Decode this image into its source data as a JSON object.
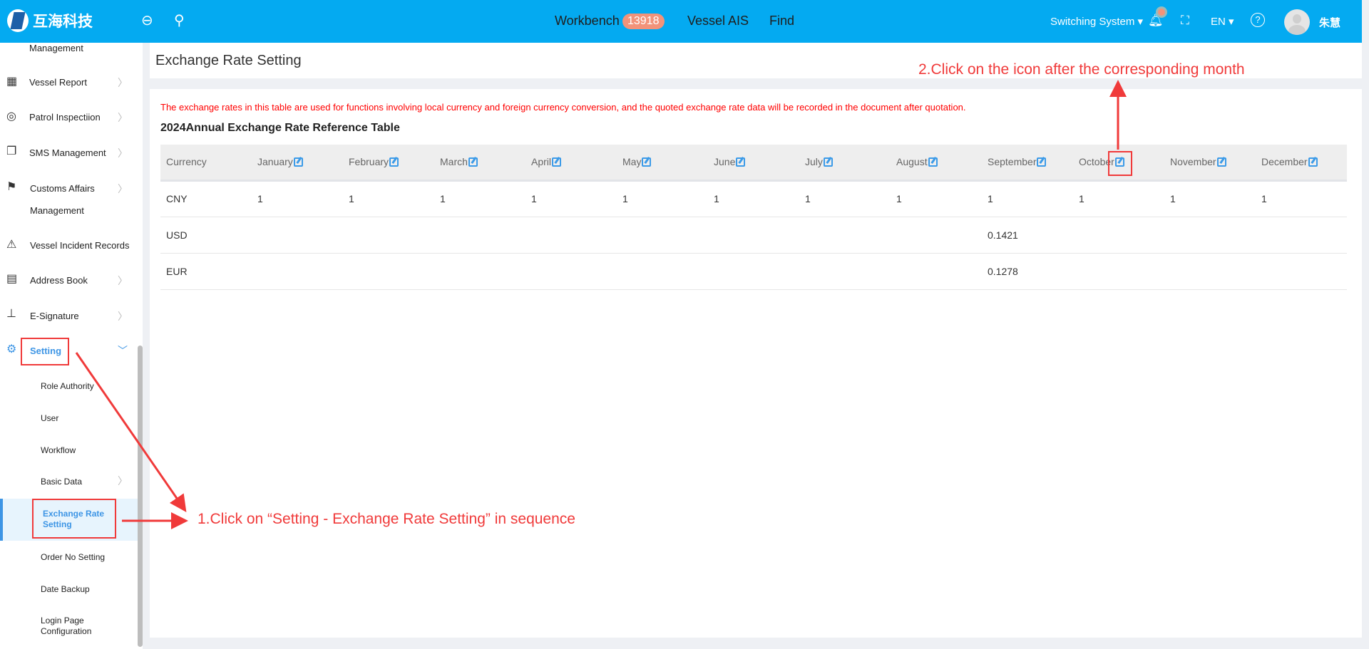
{
  "header": {
    "logo_text": "互海科技",
    "nav": [
      {
        "label": "Workbench",
        "badge": "13918"
      },
      {
        "label": "Vessel AIS"
      },
      {
        "label": "Find"
      }
    ],
    "switching_system": "Switching System",
    "language": "EN",
    "user_name": "朱慧",
    "notification_dot_color": "#f2937a"
  },
  "sidebar": {
    "items": [
      {
        "label": "Management"
      },
      {
        "label": "Vessel Report",
        "icon": "calendar-icon"
      },
      {
        "label": "Patrol Inspectiion",
        "icon": "check-circle-icon"
      },
      {
        "label": "SMS Management",
        "icon": "documents-icon"
      },
      {
        "label": "Customs Affairs",
        "label2": "Management",
        "icon": "signpost-icon"
      },
      {
        "label": "Vessel Incident Records",
        "icon": "warning-icon"
      },
      {
        "label": "Address Book",
        "icon": "address-book-icon"
      },
      {
        "label": "E-Signature",
        "icon": "stamp-icon"
      },
      {
        "label": "Setting",
        "icon": "gear-icon"
      }
    ],
    "setting_children": [
      {
        "label": "Role Authority"
      },
      {
        "label": "User"
      },
      {
        "label": "Workflow"
      },
      {
        "label": "Basic Data"
      },
      {
        "label": "Exchange Rate",
        "label2": "Setting",
        "active": true
      },
      {
        "label": "Order No Setting"
      },
      {
        "label": "Date Backup"
      },
      {
        "label": "Login Page",
        "label2": "Configuration"
      }
    ]
  },
  "page": {
    "title": "Exchange Rate Setting",
    "note": "The exchange rates in this table are used for functions involving local currency and foreign currency conversion, and the quoted exchange rate data will be recorded in the document after quotation.",
    "table_title": "2024Annual Exchange Rate Reference Table",
    "columns": [
      "Currency",
      "January",
      "February",
      "March",
      "April",
      "May",
      "June",
      "July",
      "August",
      "September",
      "October",
      "November",
      "December"
    ],
    "rows": [
      [
        "CNY",
        "1",
        "1",
        "1",
        "1",
        "1",
        "1",
        "1",
        "1",
        "1",
        "1",
        "1",
        "1"
      ],
      [
        "USD",
        "",
        "",
        "",
        "",
        "",
        "",
        "",
        "",
        "0.1421",
        "",
        "",
        ""
      ],
      [
        "EUR",
        "",
        "",
        "",
        "",
        "",
        "",
        "",
        "",
        "0.1278",
        "",
        "",
        ""
      ]
    ]
  },
  "annotations": {
    "step1": "1.Click on “Setting - Exchange Rate Setting” in sequence",
    "step2": "2.Click on the icon after the corresponding month",
    "color": "#f03a3a"
  },
  "colors": {
    "header": "#04aaf1",
    "accent": "#3d95e5",
    "note": "#ff0000"
  }
}
